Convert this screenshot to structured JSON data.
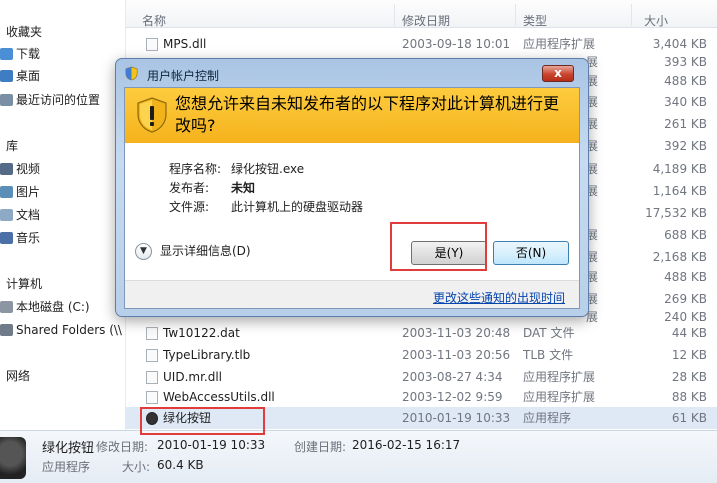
{
  "nav": {
    "favorites": "收藏夹",
    "downloads": "下载",
    "desktop": "桌面",
    "recent": "最近访问的位置",
    "libraries": "库",
    "videos": "视频",
    "pictures": "图片",
    "documents": "文档",
    "music": "音乐",
    "computer": "计算机",
    "local_disk": "本地磁盘 (C:)",
    "shared_folders": "Shared Folders (\\\\",
    "network": "网络"
  },
  "columns": {
    "name": "名称",
    "modified": "修改日期",
    "type": "类型",
    "size": "大小"
  },
  "files": [
    {
      "name": "MPS.dll",
      "date": "2003-09-18 10:01",
      "type": "应用程序扩展",
      "size": "3,404 KB"
    },
    {
      "name": "",
      "date": "",
      "type": "展",
      "size": "393 KB"
    },
    {
      "name": "",
      "date": "",
      "type": "展",
      "size": "488 KB"
    },
    {
      "name": "",
      "date": "",
      "type": "展",
      "size": "340 KB"
    },
    {
      "name": "",
      "date": "",
      "type": "展",
      "size": "261 KB"
    },
    {
      "name": "",
      "date": "",
      "type": "展",
      "size": "392 KB"
    },
    {
      "name": "",
      "date": "",
      "type": "展",
      "size": "4,189 KB"
    },
    {
      "name": "",
      "date": "",
      "type": "展",
      "size": "1,164 KB"
    },
    {
      "name": "",
      "date": "",
      "type": "",
      "size": "17,532 KB"
    },
    {
      "name": "",
      "date": "",
      "type": "展",
      "size": "688 KB"
    },
    {
      "name": "",
      "date": "",
      "type": "展",
      "size": "2,168 KB"
    },
    {
      "name": "",
      "date": "",
      "type": "展",
      "size": "488 KB"
    },
    {
      "name": "",
      "date": "",
      "type": "展",
      "size": "269 KB"
    },
    {
      "name": "",
      "date": "",
      "type": "展",
      "size": "240 KB"
    },
    {
      "name": "Tw10122.dat",
      "date": "2003-11-03 20:48",
      "type": "DAT 文件",
      "size": "44 KB"
    },
    {
      "name": "TypeLibrary.tlb",
      "date": "2003-11-03 20:56",
      "type": "TLB 文件",
      "size": "12 KB"
    },
    {
      "name": "UID.mr.dll",
      "date": "2003-08-27 4:34",
      "type": "应用程序扩展",
      "size": "28 KB"
    },
    {
      "name": "WebAccessUtils.dll",
      "date": "2003-12-02 9:59",
      "type": "应用程序扩展",
      "size": "88 KB"
    },
    {
      "name": "绿化按钮",
      "date": "2010-01-19 10:33",
      "type": "应用程序",
      "size": "61 KB"
    }
  ],
  "details": {
    "name": "绿化按钮",
    "kind": "应用程序",
    "modified_label": "修改日期:",
    "modified_value": "2010-01-19 10:33",
    "created_label": "创建日期:",
    "created_value": "2016-02-15 16:17",
    "size_label": "大小:",
    "size_value": "60.4 KB"
  },
  "uac": {
    "title": "用户帐户控制",
    "close": "x",
    "question": "您想允许来自未知发布者的以下程序对此计算机进行更改吗?",
    "program_label": "程序名称:",
    "program_value": "绿化按钮.exe",
    "publisher_label": "发布者:",
    "publisher_value": "未知",
    "source_label": "文件源:",
    "source_value": "此计算机上的硬盘驱动器",
    "details_toggle": "显示详细信息(D)",
    "yes": "是(Y)",
    "no": "否(N)",
    "link": "更改这些通知的出现时间"
  },
  "colors": {
    "banner": "#f9bf2c",
    "highlight": "#e23b3b",
    "link": "#0645ad"
  }
}
